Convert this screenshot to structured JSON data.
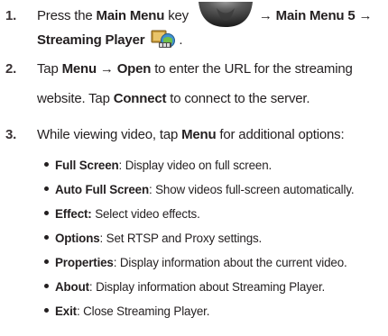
{
  "steps": [
    {
      "number": "1.",
      "line1": {
        "pre": "Press the ",
        "bold1": "Main Menu",
        "mid": " key ",
        "post": " → ",
        "bold2": "Main Menu 5",
        "arrow": " →"
      },
      "line2": {
        "bold": "Streaming Player",
        "end": "."
      }
    },
    {
      "number": "2.",
      "line1": {
        "pre": "Tap ",
        "bold1": "Menu",
        "arrow": " → ",
        "bold2": "Open",
        "post": " to enter the URL for the streaming"
      },
      "line2": {
        "pre": "website.  Tap ",
        "bold": "Connect",
        "post": " to connect to the server."
      }
    },
    {
      "number": "3.",
      "line1": {
        "pre": "While viewing video, tap ",
        "bold": "Menu",
        "post": " for additional options:"
      }
    }
  ],
  "options": [
    {
      "label": "Full Screen",
      "sep": ":",
      "desc": " Display video on full screen."
    },
    {
      "label": "Auto Full Screen",
      "sep": ":",
      "desc": " Show videos full-screen automatically."
    },
    {
      "label": "Effect:",
      "sep": "",
      "desc": " Select video effects."
    },
    {
      "label": "Options",
      "sep": ":",
      "desc": " Set RTSP and Proxy settings."
    },
    {
      "label": "Properties",
      "sep": ":",
      "desc": " Display information about the current video."
    },
    {
      "label": "About",
      "sep": ":",
      "desc": " Display information about Streaming Player."
    },
    {
      "label": "Exit",
      "sep": ":",
      "desc": " Close Streaming Player."
    }
  ],
  "icons": {
    "main_menu_key": "main-menu-key-icon",
    "streaming_player": "streaming-player-icon"
  },
  "colors": {
    "text": "#231f20",
    "key_dark": "#2a2a2a",
    "key_light": "#8a8a8a"
  }
}
